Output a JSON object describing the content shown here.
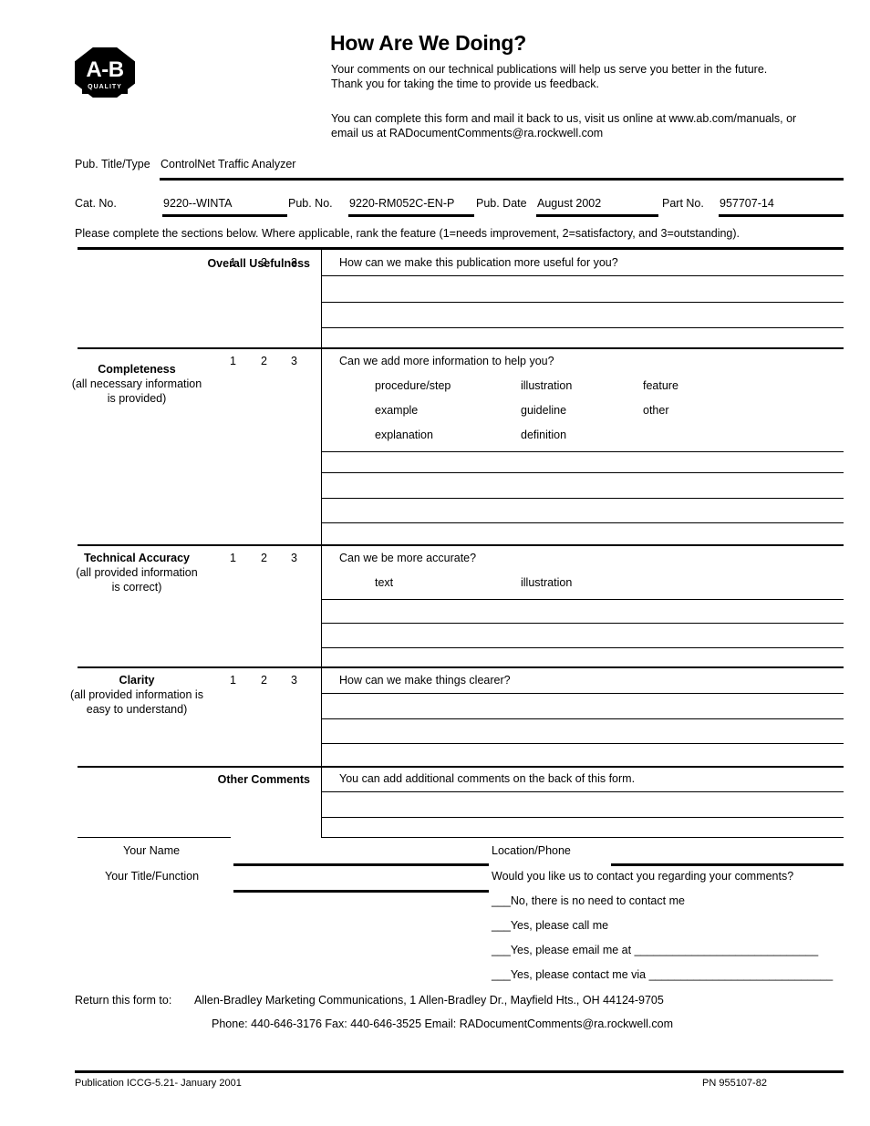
{
  "header": {
    "logo_text": "A-B",
    "logo_banner": "QUALITY",
    "title": "How Are We Doing?",
    "subtitle_line1": "Your comments on our technical publications will help us serve you better in the future.",
    "subtitle_line2": "Thank you for taking the time to provide us feedback.",
    "online_line1": "You can complete this form and mail it back to us, visit us online at www.ab.com/manuals, or",
    "online_line2": "email us at RADocumentComments@ra.rockwell.com"
  },
  "pub_info": {
    "title_type_label": "Pub. Title/Type",
    "title_type_value": "ControlNet Traffic Analyzer",
    "cat_no_label": "Cat. No.",
    "cat_no_value": "9220--WINTA",
    "pub_no_label": "Pub. No.",
    "pub_no_value": "9220-RM052C-EN-P",
    "pub_date_label": "Pub. Date",
    "pub_date_value": "August 2002",
    "part_no_label": "Part No.",
    "part_no_value": "957707-14"
  },
  "instruction": "Please complete the sections below. Where applicable, rank the feature (1=needs improvement, 2=satisfactory, and 3=outstanding).",
  "ratings": [
    "1",
    "2",
    "3"
  ],
  "sections": [
    {
      "name": "Overall Usefulness",
      "sub": "",
      "question": "How can we make this publication more useful for you?",
      "options": []
    },
    {
      "name": "Completeness",
      "sub_line1": "(all necessary information",
      "sub_line2": "is provided)",
      "question": "Can we add more information to help you?",
      "options": [
        [
          "procedure/step",
          "illustration",
          "feature"
        ],
        [
          "example",
          "guideline",
          "other"
        ],
        [
          "explanation",
          "definition",
          ""
        ]
      ]
    },
    {
      "name": "Technical Accuracy",
      "sub_line1": "(all provided information",
      "sub_line2": "is correct)",
      "question": "Can we be more accurate?",
      "options": [
        [
          "text",
          "illustration",
          ""
        ]
      ]
    },
    {
      "name": "Clarity",
      "sub_line1": "(all provided information is",
      "sub_line2": "easy to understand)",
      "question": "How can we make things clearer?",
      "options": []
    },
    {
      "name": "Other Comments",
      "sub": "",
      "question": "You can add additional comments on the back of this form.",
      "options": []
    }
  ],
  "contact": {
    "your_name_label": "Your Name",
    "your_title_label": "Your Title/Function",
    "location_phone_label": "Location/Phone",
    "contact_question": "Would you like us to contact you regarding your comments?",
    "choices": [
      "___No, there is no need to contact me",
      "___Yes, please call me",
      "___Yes, please email me at _____________________________",
      "___Yes, please contact me via _____________________________"
    ]
  },
  "return_info": {
    "label": "Return this form to:",
    "address": "Allen-Bradley Marketing Communications, 1 Allen-Bradley Dr., Mayfield Hts., OH 44124-9705",
    "phone_line": "Phone: 440-646-3176 Fax: 440-646-3525 Email: RADocumentComments@ra.rockwell.com"
  },
  "footer": {
    "publication": "Publication  ICCG-5.21- January 2001",
    "pn": "PN 955107-82"
  }
}
